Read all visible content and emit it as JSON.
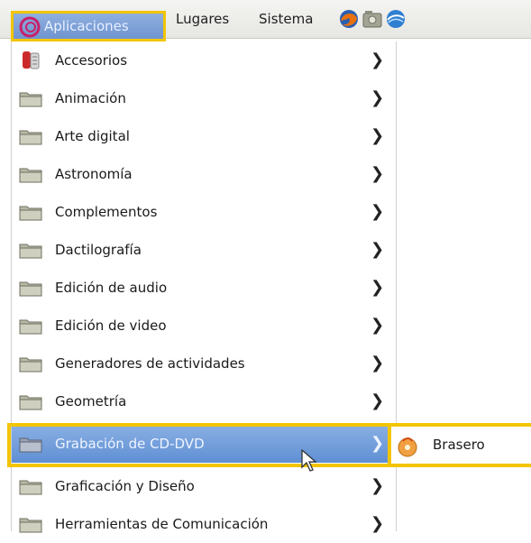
{
  "panel": {
    "applications_label": "Aplicaciones",
    "places_label": "Lugares",
    "system_label": "Sistema",
    "launchers": [
      "firefox-icon",
      "screenshot-icon",
      "network-icon"
    ]
  },
  "menu": {
    "items": [
      {
        "label": "Accesorios",
        "icon": "accessories-icon"
      },
      {
        "label": "Animación",
        "icon": "folder-icon"
      },
      {
        "label": "Arte digital",
        "icon": "folder-icon"
      },
      {
        "label": "Astronomía",
        "icon": "folder-icon"
      },
      {
        "label": "Complementos",
        "icon": "folder-icon"
      },
      {
        "label": "Dactilografía",
        "icon": "folder-icon"
      },
      {
        "label": "Edición de audio",
        "icon": "folder-icon"
      },
      {
        "label": "Edición de video",
        "icon": "folder-icon"
      },
      {
        "label": "Generadores de actividades",
        "icon": "folder-icon"
      },
      {
        "label": "Geometría",
        "icon": "folder-icon"
      },
      {
        "label": "Grabación de CD-DVD",
        "icon": "folder-icon",
        "active": true
      },
      {
        "label": "Graficación y Diseño",
        "icon": "folder-icon"
      },
      {
        "label": "Herramientas de Comunicación",
        "icon": "folder-icon"
      }
    ],
    "submenu_arrow": "❯"
  },
  "submenu": {
    "items": [
      {
        "label": "Brasero",
        "icon": "brasero-icon"
      }
    ]
  },
  "colors": {
    "highlight_outline": "#f2c500",
    "active_row": "#6f98d6"
  }
}
